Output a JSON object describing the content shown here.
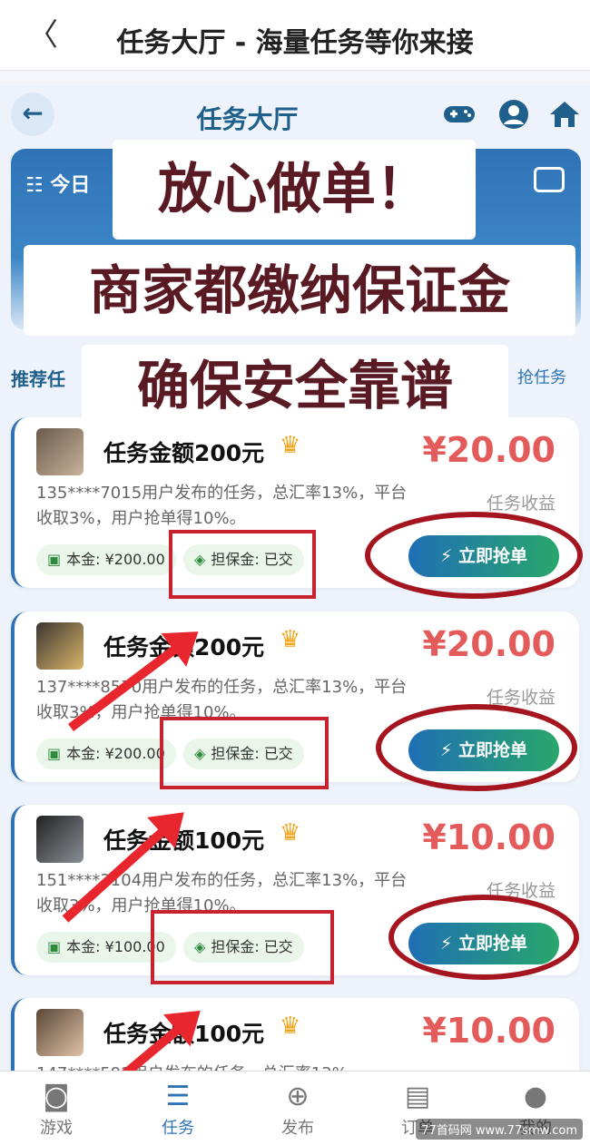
{
  "topbar": {
    "back": "〈",
    "title": "任务大厅 - 海量任务等你来接"
  },
  "header": {
    "back": "←",
    "title": "任务大厅"
  },
  "banner": {
    "label": "今日"
  },
  "tabs": {
    "left": "推荐任",
    "right": "抢任务"
  },
  "overlay": {
    "line1": "放心做单！",
    "line2": "商家都缴纳保证金",
    "line3": "确保安全靠谱"
  },
  "cards": [
    {
      "title": "任务金额200元",
      "price": "¥20.00",
      "desc": "135****7015用户发布的任务，总汇率13%，平台收取3%，用户抢单得10%。",
      "earn": "任务收益",
      "principal": "本金: ¥200.00",
      "deposit": "担保金: 已交",
      "button": "立即抢单"
    },
    {
      "title": "任务金额200元",
      "price": "¥20.00",
      "desc": "137****8570用户发布的任务，总汇率13%，平台收取3%，用户抢单得10%。",
      "earn": "任务收益",
      "principal": "本金: ¥200.00",
      "deposit": "担保金: 已交",
      "button": "立即抢单"
    },
    {
      "title": "任务金额100元",
      "price": "¥10.00",
      "desc": "151****3104用户发布的任务，总汇率13%，平台收取3%，用户抢单得10%。",
      "earn": "任务收益",
      "principal": "本金: ¥100.00",
      "deposit": "担保金: 已交",
      "button": "立即抢单"
    },
    {
      "title": "任务金额100元",
      "price": "¥10.00",
      "desc": "147****592用户发布的任务，总汇率13%",
      "earn": "",
      "principal": "",
      "deposit": "",
      "button": ""
    }
  ],
  "tabbar": [
    {
      "label": "游戏",
      "icon": "gamepad-icon"
    },
    {
      "label": "任务",
      "icon": "list-icon"
    },
    {
      "label": "发布",
      "icon": "plus-icon"
    },
    {
      "label": "订单",
      "icon": "document-icon"
    },
    {
      "label": "我的",
      "icon": "person-icon"
    }
  ],
  "watermark": "77首码网 www.77smw.com",
  "colors": {
    "accent": "#2f73b6",
    "price": "#e45b5b",
    "annotation": "#c8222e"
  }
}
